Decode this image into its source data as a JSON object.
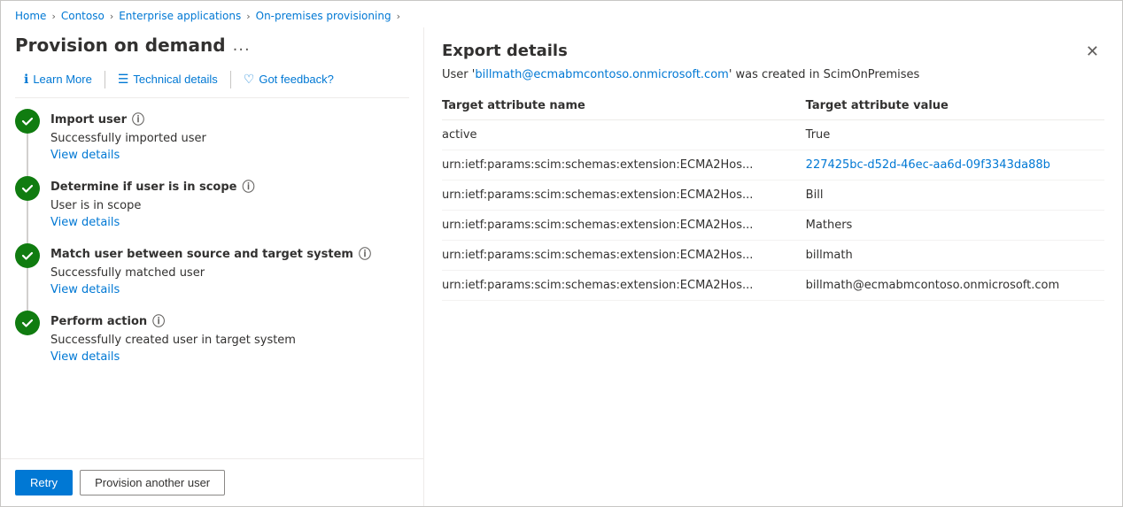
{
  "breadcrumb": {
    "items": [
      {
        "label": "Home",
        "active": true
      },
      {
        "label": "Contoso",
        "active": true
      },
      {
        "label": "Enterprise applications",
        "active": true
      },
      {
        "label": "On-premises provisioning",
        "active": true
      }
    ]
  },
  "left": {
    "page_title": "Provision on demand",
    "more_label": "...",
    "toolbar": [
      {
        "id": "learn-more",
        "icon": "ℹ",
        "label": "Learn More"
      },
      {
        "id": "technical-details",
        "icon": "☰",
        "label": "Technical details"
      },
      {
        "id": "got-feedback",
        "icon": "♡",
        "label": "Got feedback?"
      }
    ],
    "steps": [
      {
        "id": "import-user",
        "title": "Import user",
        "desc": "Successfully imported user",
        "link": "View details"
      },
      {
        "id": "determine-scope",
        "title": "Determine if user is in scope",
        "desc": "User is in scope",
        "link": "View details"
      },
      {
        "id": "match-user",
        "title": "Match user between source and target system",
        "desc": "Successfully matched user",
        "link": "View details"
      },
      {
        "id": "perform-action",
        "title": "Perform action",
        "desc": "Successfully created user in target system",
        "link": "View details"
      }
    ],
    "footer": {
      "retry_label": "Retry",
      "provision_label": "Provision another user"
    }
  },
  "right": {
    "title": "Export details",
    "close_icon": "✕",
    "status_text": "User 'billmath@ecmabmcontoso.onmicrosoft.com' was created in ScimOnPremises",
    "username": "billmath@ecmabmcontoso.onmicrosoft.com",
    "table": {
      "col1": "Target attribute name",
      "col2": "Target attribute value",
      "rows": [
        {
          "attr": "active",
          "value": "True",
          "value_type": "red"
        },
        {
          "attr": "urn:ietf:params:scim:schemas:extension:ECMA2Hos...",
          "value": "227425bc-d52d-46ec-aa6d-09f3343da88b",
          "value_type": "blue"
        },
        {
          "attr": "urn:ietf:params:scim:schemas:extension:ECMA2Hos...",
          "value": "Bill",
          "value_type": "red"
        },
        {
          "attr": "urn:ietf:params:scim:schemas:extension:ECMA2Hos...",
          "value": "Mathers",
          "value_type": "red"
        },
        {
          "attr": "urn:ietf:params:scim:schemas:extension:ECMA2Hos...",
          "value": "billmath",
          "value_type": "red"
        },
        {
          "attr": "urn:ietf:params:scim:schemas:extension:ECMA2Hos...",
          "value": "billmath@ecmabmcontoso.onmicrosoft.com",
          "value_type": "red"
        }
      ]
    }
  }
}
